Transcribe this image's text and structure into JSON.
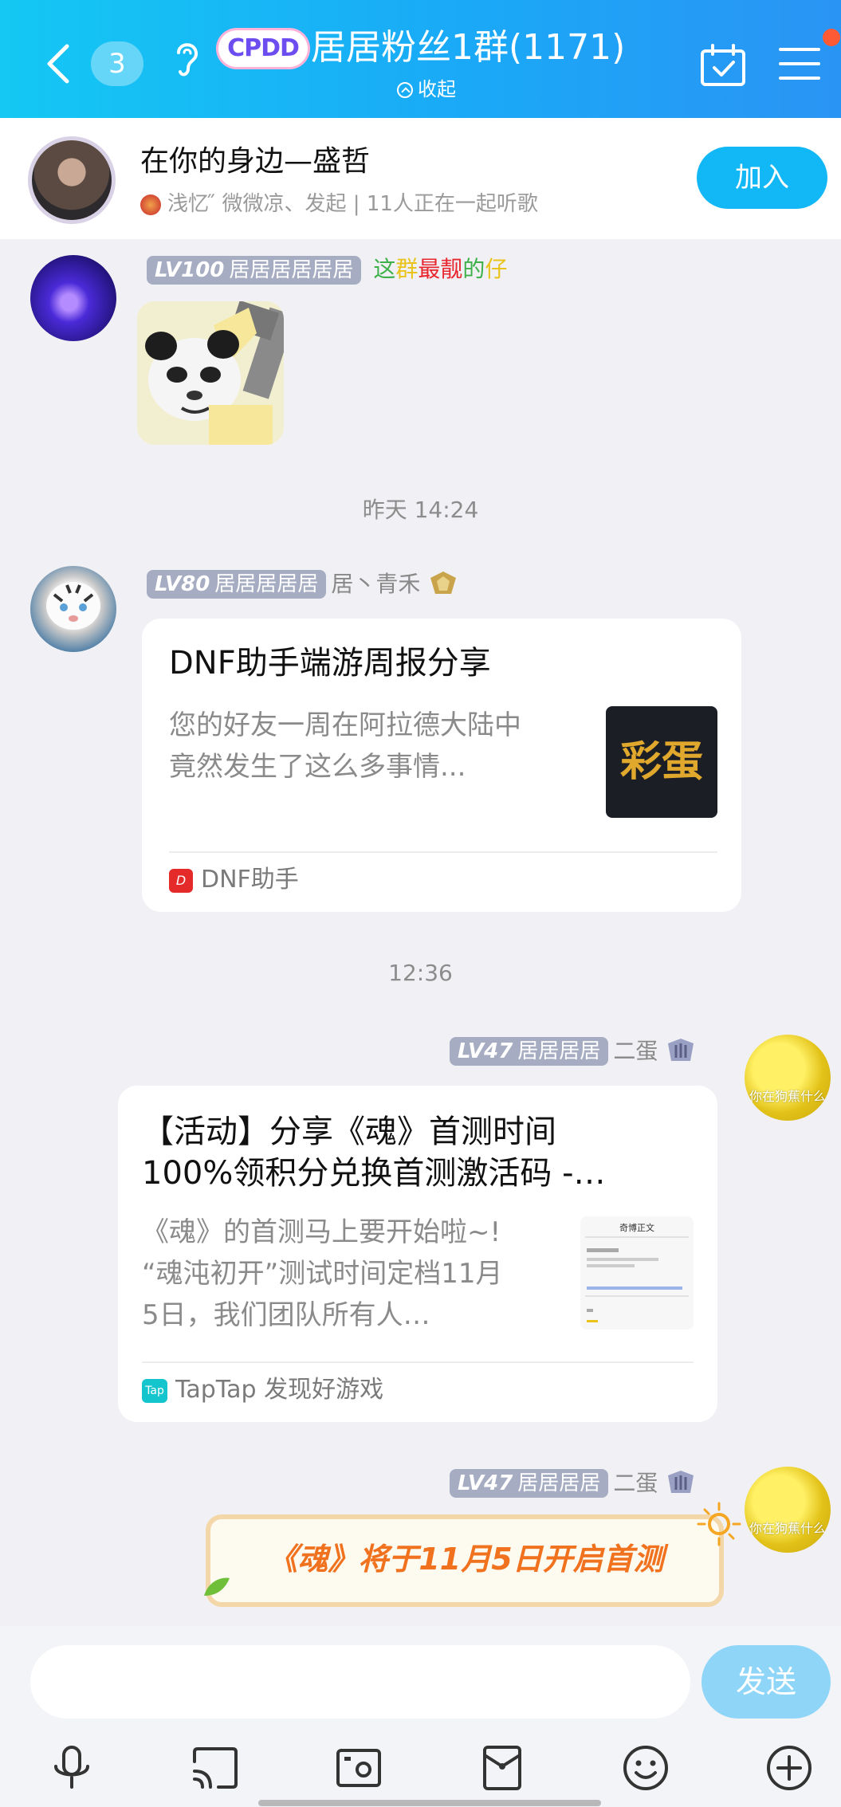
{
  "header": {
    "unread_count": "3",
    "app_logo": "CPDD",
    "group_title": "居居粉丝1群(1171)",
    "collapse_label": "收起",
    "colors": {
      "start": "#14c8f3",
      "end": "#2a94f4"
    }
  },
  "listen_together": {
    "song_title": "在你的身边—盛哲",
    "subtitle": "浅忆 ̋ 微微凉、发起 | 11人正在一起听歌",
    "join_label": "加入"
  },
  "messages": [
    {
      "level": "LV100",
      "title": "居居居居居居",
      "rainbow_text": [
        "这",
        "群",
        "最",
        "靓",
        "的",
        "仔"
      ],
      "rainbow_colors": [
        "#3db04a",
        "#e9c319",
        "#e8262e",
        "#e8262e",
        "#3db04a",
        "#e9c319"
      ],
      "type": "sticker",
      "sticker": "panda-meme"
    },
    {
      "timestamp": "昨天 14:24"
    },
    {
      "level": "LV80",
      "title": "居居居居居",
      "nickname": "居丶青禾",
      "card": {
        "title": "DNF助手端游周报分享",
        "desc_line1": "您的好友一周在阿拉德大陆中",
        "desc_line2": "竟然发生了这么多事情...",
        "thumb_text": "彩蛋",
        "source": "DNF助手"
      }
    },
    {
      "timestamp": "12:36"
    },
    {
      "level": "LV47",
      "title": "居居居居",
      "nickname": "二蛋",
      "avatar_caption": "你在狗蕉什么",
      "card": {
        "title_line1": "【活动】分享《魂》首测时间",
        "title_line2": "100%领积分兑换首测激活码 -…",
        "desc_line1": "《魂》的首测马上要开始啦~!",
        "desc_line2": "“魂沌初开”测试时间定档11月",
        "desc_line3": "5日，我们团队所有人…",
        "thumb_title": "奇博正文",
        "source_badge": "Tap",
        "source": "TapTap 发现好游戏"
      }
    },
    {
      "level": "LV47",
      "title": "居居居居",
      "nickname": "二蛋",
      "avatar_caption": "你在狗蕉什么",
      "banner_text": "《魂》将于11月5日开启首测"
    }
  ],
  "input": {
    "placeholder": "",
    "send_label": "发送"
  },
  "toolbar": [
    "microphone-icon",
    "screen-cast-icon",
    "photo-icon",
    "red-packet-icon",
    "emoji-icon",
    "plus-icon"
  ]
}
